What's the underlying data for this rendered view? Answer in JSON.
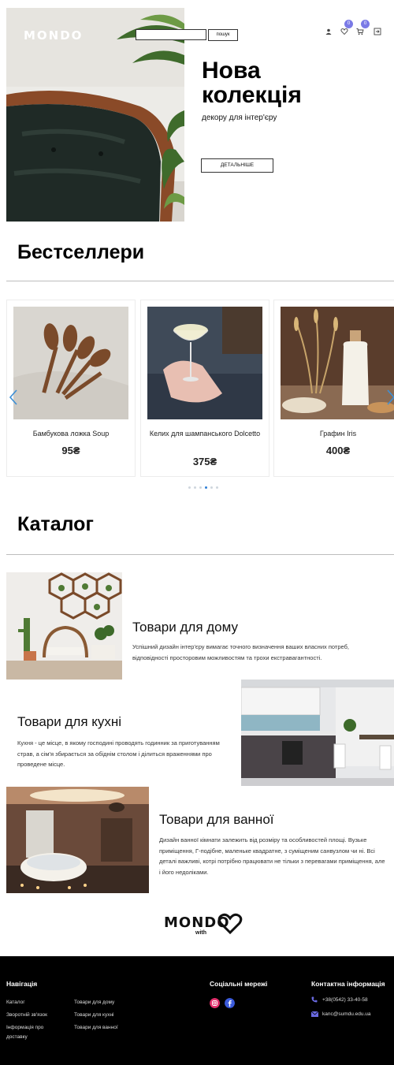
{
  "header": {
    "logo": "MONDO",
    "search": {
      "placeholder": "",
      "button_label": "пошук"
    },
    "wishlist_count": "0",
    "cart_count": "0"
  },
  "hero": {
    "title": "Нова колекція",
    "subtitle": "декору для інтер'єру",
    "button_label": "ДЕТАЛЬНІШЕ"
  },
  "bestsellers": {
    "title": "Бестселлери",
    "products": [
      {
        "name": "Бамбукова ложка Soup",
        "price": "95₴"
      },
      {
        "name": "Келих для шампанського Dolcetto",
        "price": "375₴"
      },
      {
        "name": "Графин Iris",
        "price": "400₴"
      }
    ],
    "dots_total": 6,
    "dots_active": 4
  },
  "catalog": {
    "title": "Каталог",
    "items": [
      {
        "title": "Товари для дому",
        "description": "Успішний дизайн інтер'єру вимагає точного визначення ваших власних потреб, відповідності просторовим можливостям та трохи екстравагантності."
      },
      {
        "title": "Товари для кухні",
        "description": "Кухня - це місце, в якому господині проводять годинник за приготуванням страв, а сім'я збирається за обіднім столом і ділиться враженнями про проведене місце."
      },
      {
        "title": "Товари для ванної",
        "description": "Дизайн ванної кімнати залежить від розміру та особливостей площі. Вузьке приміщення, Г-подібне, маленьке квадратне, з суміщеним санвузлом чи ні. Всі деталі важливі, котрі потрібно працювати не тільки з перевагами приміщення, але і його недоліками."
      }
    ]
  },
  "brand": {
    "name": "MONDO",
    "sub": "with"
  },
  "footer": {
    "nav_title": "Навігація",
    "nav_col1": [
      "Каталог",
      "Зворотній зв'язок",
      "Інформація про доставку"
    ],
    "nav_col2": [
      "Товари для дому",
      "Товари для кухні",
      "Товари для ванної"
    ],
    "social_title": "Соціальні мережі",
    "contact_title": "Контактна інформація",
    "phone": "+38(0542) 33-40-58",
    "email": "kanc@sumdu.edu.ua"
  },
  "colors": {
    "badge": "#7a7ae6",
    "arrow": "#3d8fd6",
    "footer_bg": "#000000",
    "instagram": "#e1306c",
    "facebook": "#3b5bdb"
  }
}
